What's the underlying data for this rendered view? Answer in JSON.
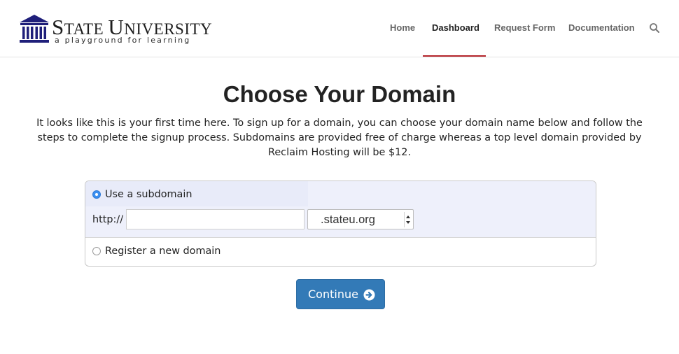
{
  "header": {
    "logo_title_first": "S",
    "logo_title_rest1": "TATE ",
    "logo_title_second": "U",
    "logo_title_rest2": "NIVERSITY",
    "logo_tagline": "a playground for learning",
    "nav": [
      {
        "label": "Home",
        "active": false
      },
      {
        "label": "Dashboard",
        "active": true
      },
      {
        "label": "Request Form",
        "active": false
      },
      {
        "label": "Documentation",
        "active": false
      }
    ],
    "search_icon": "search-icon",
    "accent_color": "#b5262c"
  },
  "main": {
    "title": "Choose Your Domain",
    "intro": "It looks like this is your first time here. To sign up for a domain, you can choose your domain name below and follow the steps to complete the signup process. Subdomains are provided free of charge whereas a top level domain provided by Reclaim Hosting will be $12.",
    "options": {
      "subdomain_label": "Use a subdomain",
      "subdomain_selected": true,
      "new_domain_label": "Register a new domain",
      "new_domain_selected": false
    },
    "subdomain": {
      "prefix": "http://",
      "input_value": "",
      "input_placeholder": "",
      "suffix_selected": ".stateu.org"
    },
    "continue_label": "Continue",
    "continue_icon": "arrow-circle-right-icon",
    "button_color": "#337ab7"
  }
}
